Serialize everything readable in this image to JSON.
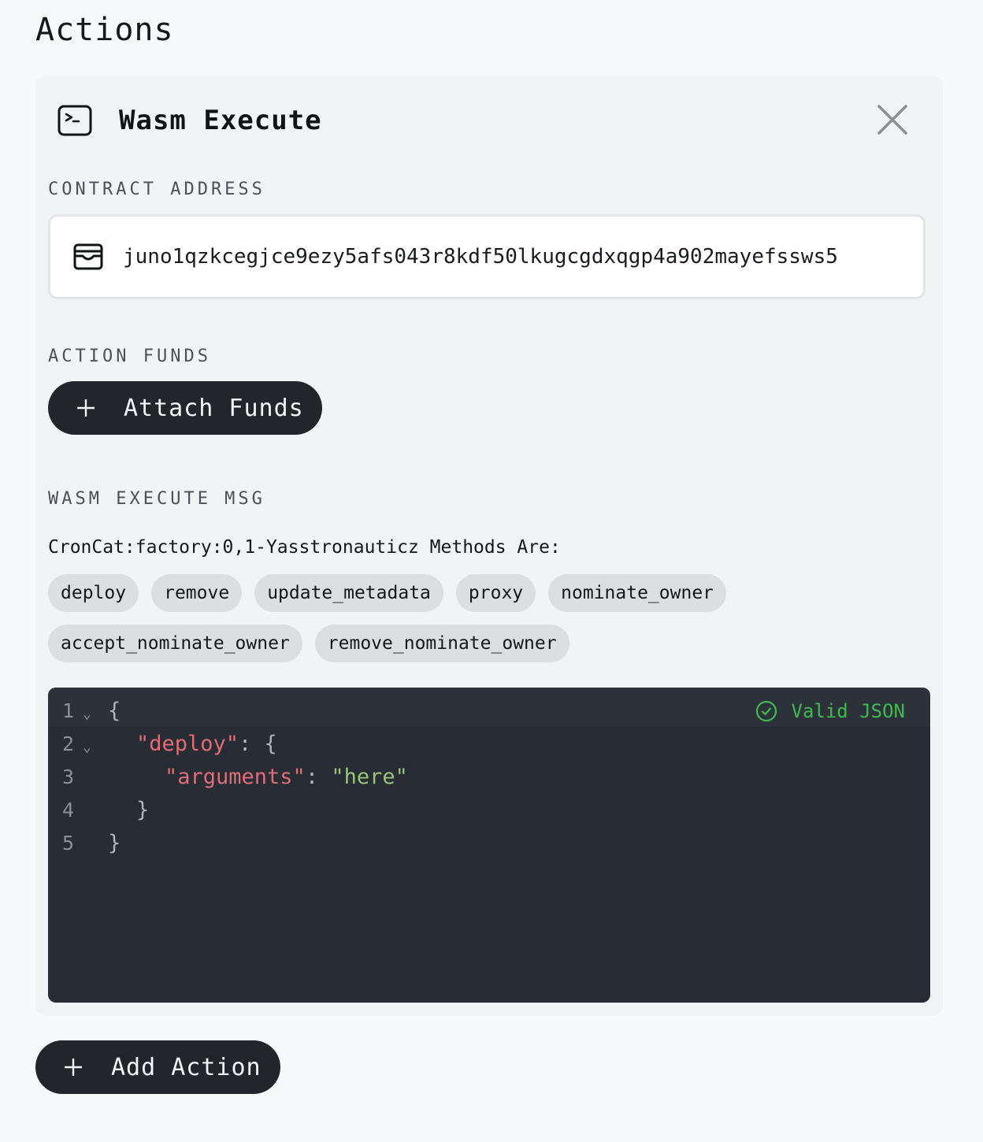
{
  "page_title": "Actions",
  "action_card": {
    "title": "Wasm Execute",
    "icon": "terminal-icon",
    "close_icon": "close-icon",
    "contract_address": {
      "label": "CONTRACT ADDRESS",
      "icon": "wallet-icon",
      "value": "juno1qzkcegjce9ezy5afs043r8kdf50lkugcgdxqgp4a902mayefssws5"
    },
    "action_funds": {
      "label": "ACTION FUNDS",
      "button_label": "Attach Funds"
    },
    "execute_msg": {
      "label": "WASM EXECUTE MSG",
      "methods_caption": "CronCat:factory:0,1-Yasstronauticz Methods Are:",
      "methods": [
        "deploy",
        "remove",
        "update_metadata",
        "proxy",
        "nominate_owner",
        "accept_nominate_owner",
        "remove_nominate_owner"
      ],
      "editor": {
        "status": "Valid JSON",
        "status_color": "#3fb950",
        "line_numbers": [
          "1",
          "2",
          "3",
          "4",
          "5"
        ],
        "lines": [
          {
            "punct_open": "{"
          },
          {
            "key": "\"deploy\"",
            "punct": ": {"
          },
          {
            "key": "\"arguments\"",
            "punct": ": ",
            "value": "\"here\""
          },
          {
            "punct_open": "}"
          },
          {
            "punct_open": "}"
          }
        ]
      }
    }
  },
  "add_action": {
    "button_label": "Add Action"
  }
}
